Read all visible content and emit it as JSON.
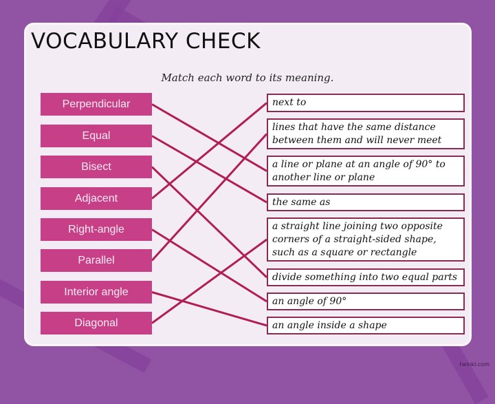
{
  "title": "VOCABULARY CHECK",
  "instruction": "Match each word to its meaning.",
  "words": [
    {
      "label": "Perpendicular"
    },
    {
      "label": "Equal"
    },
    {
      "label": "Bisect"
    },
    {
      "label": "Adjacent"
    },
    {
      "label": "Right-angle"
    },
    {
      "label": "Parallel"
    },
    {
      "label": "Interior angle"
    },
    {
      "label": "Diagonal"
    }
  ],
  "meanings": [
    {
      "text": "next to"
    },
    {
      "text": "lines that have the same distance between them and will never meet"
    },
    {
      "text": "a line or plane at an angle of 90° to another line or plane"
    },
    {
      "text": "the same as"
    },
    {
      "text": "a straight line joining two opposite corners of a straight-sided shape, such as a square or rectangle"
    },
    {
      "text": "divide something into two equal parts"
    },
    {
      "text": "an angle of 90°"
    },
    {
      "text": "an angle inside a shape"
    }
  ],
  "matches": [
    {
      "word": "Perpendicular",
      "meaning_index": 2
    },
    {
      "word": "Equal",
      "meaning_index": 3
    },
    {
      "word": "Bisect",
      "meaning_index": 5
    },
    {
      "word": "Adjacent",
      "meaning_index": 0
    },
    {
      "word": "Right-angle",
      "meaning_index": 6
    },
    {
      "word": "Parallel",
      "meaning_index": 1
    },
    {
      "word": "Interior angle",
      "meaning_index": 7
    },
    {
      "word": "Diagonal",
      "meaning_index": 4
    }
  ],
  "colors": {
    "background": "#9153a3",
    "word_box": "#c74087",
    "line": "#b01e55",
    "meaning_border": "#8a2a50"
  },
  "watermark": "twinkl.com"
}
